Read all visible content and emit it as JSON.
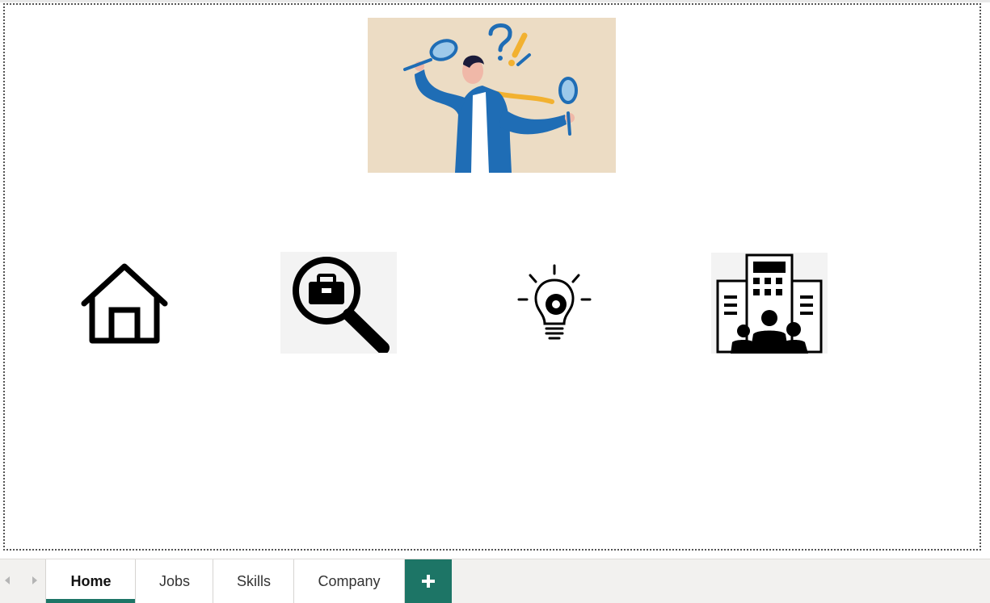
{
  "report": {
    "hero_image": "person-with-magnifying-glasses-illustration",
    "nav_icons": [
      {
        "name": "home-icon"
      },
      {
        "name": "job-search-icon"
      },
      {
        "name": "skills-lightbulb-icon"
      },
      {
        "name": "company-building-icon"
      }
    ]
  },
  "tabs": [
    {
      "label": "Home",
      "active": true
    },
    {
      "label": "Jobs",
      "active": false
    },
    {
      "label": "Skills",
      "active": false
    },
    {
      "label": "Company",
      "active": false
    }
  ],
  "add_tab_icon": "plus-icon",
  "colors": {
    "accent": "#1d7566",
    "hero_bg": "#ecdcc4",
    "jacket_blue": "#1f6db5",
    "tie_yellow": "#f2b130"
  }
}
